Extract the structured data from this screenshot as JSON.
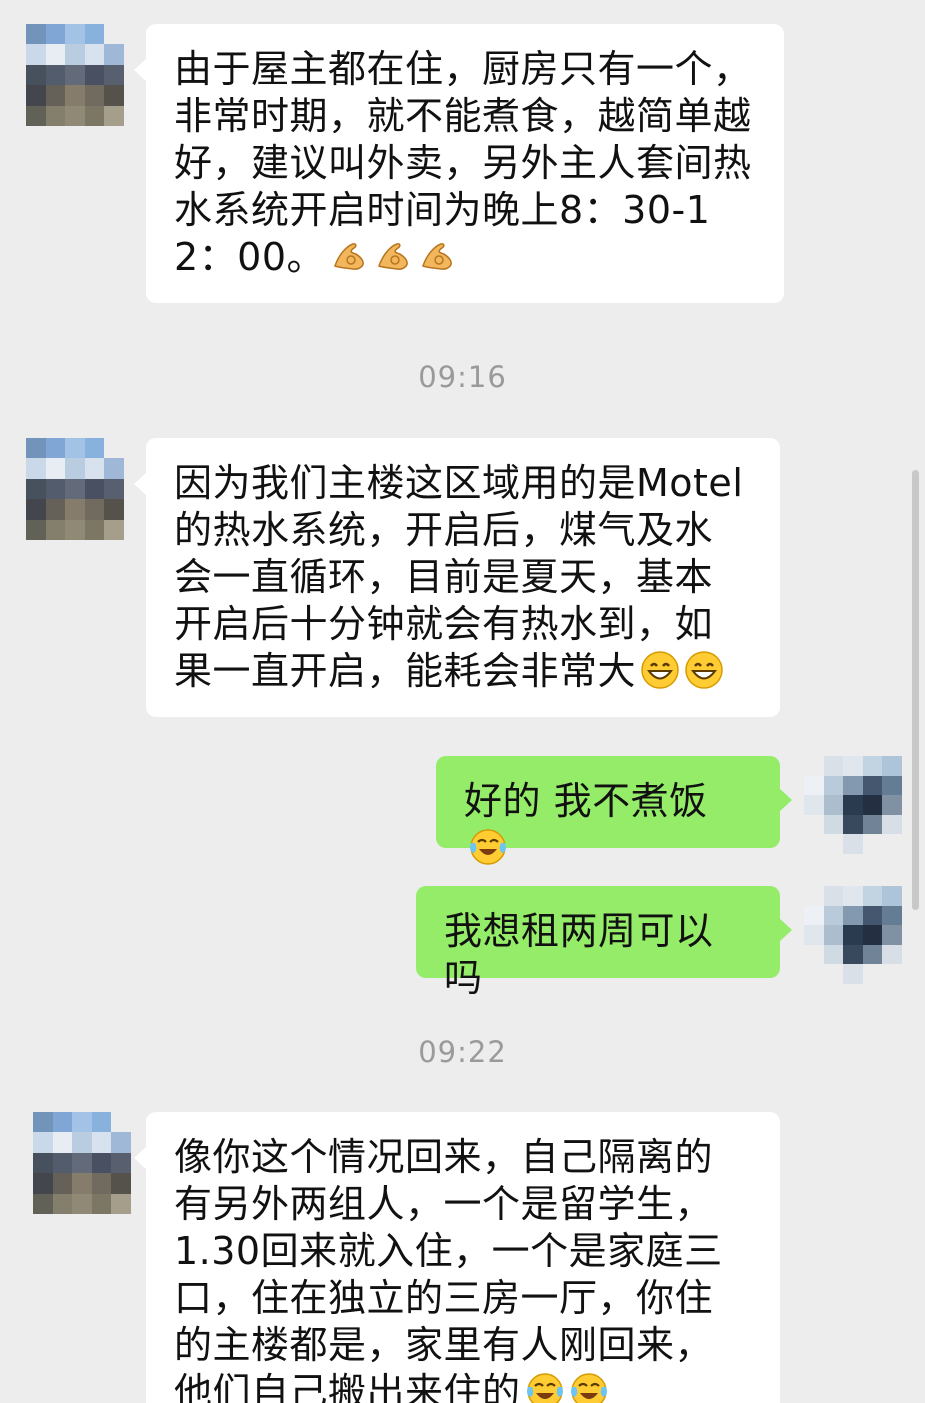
{
  "messages": [
    {
      "sender": "host",
      "text": "由于屋主都在住，厨房只有一个，非常时期，就不能煮食，越简单越好，建议叫外卖，另外主人套间热水系统开启时间为晚上8：30-12：00。",
      "emoji": [
        "ok-hand",
        "ok-hand",
        "ok-hand"
      ]
    },
    {
      "time": "09:16"
    },
    {
      "sender": "host",
      "text": "因为我们主楼这区域用的是Motel的热水系统，开启后，煤气及水会一直循环，目前是夏天，基本开启后十分钟就会有热水到，如果一直开启，能耗会非常大",
      "emoji": [
        "grin",
        "grin"
      ]
    },
    {
      "sender": "me",
      "text": "好的 我不煮饭",
      "emoji": [
        "tears-of-joy"
      ]
    },
    {
      "sender": "me",
      "text": "我想租两周可以吗",
      "emoji": []
    },
    {
      "time": "09:22"
    },
    {
      "sender": "host",
      "text": "像你这个情况回来，自己隔离的有另外两组人，一个是留学生，1.30回来就入住，一个是家庭三口，住在独立的三房一厅，你住的主楼都是，家里有人刚回来，他们自己搬出来住的",
      "emoji": [
        "tears-of-joy",
        "tears-of-joy"
      ]
    }
  ],
  "colors": {
    "background": "#ededed",
    "incoming_bubble": "#ffffff",
    "outgoing_bubble": "#95ec69",
    "timestamp": "#9a9a9a"
  }
}
